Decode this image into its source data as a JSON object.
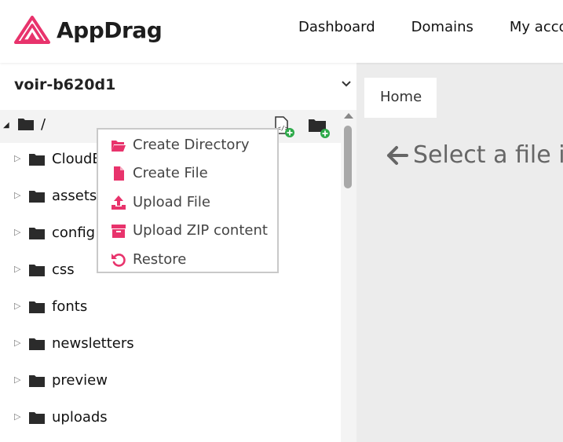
{
  "header": {
    "logo_text": "AppDrag",
    "nav": [
      "Dashboard",
      "Domains",
      "My acco"
    ]
  },
  "sidebar": {
    "project_name": "voir-b620d1",
    "root_label": "/",
    "items": [
      "CloudB",
      "assets",
      "config",
      "css",
      "fonts",
      "newsletters",
      "preview",
      "uploads"
    ]
  },
  "context_menu": {
    "items": [
      "Create Directory",
      "Create File",
      "Upload File",
      "Upload ZIP content",
      "Restore"
    ]
  },
  "main": {
    "tab_label": "Home",
    "placeholder": "Select a file in t"
  },
  "colors": {
    "accent": "#e8336c",
    "add_badge": "#2eaa4a",
    "folder": "#2b2b2b"
  }
}
